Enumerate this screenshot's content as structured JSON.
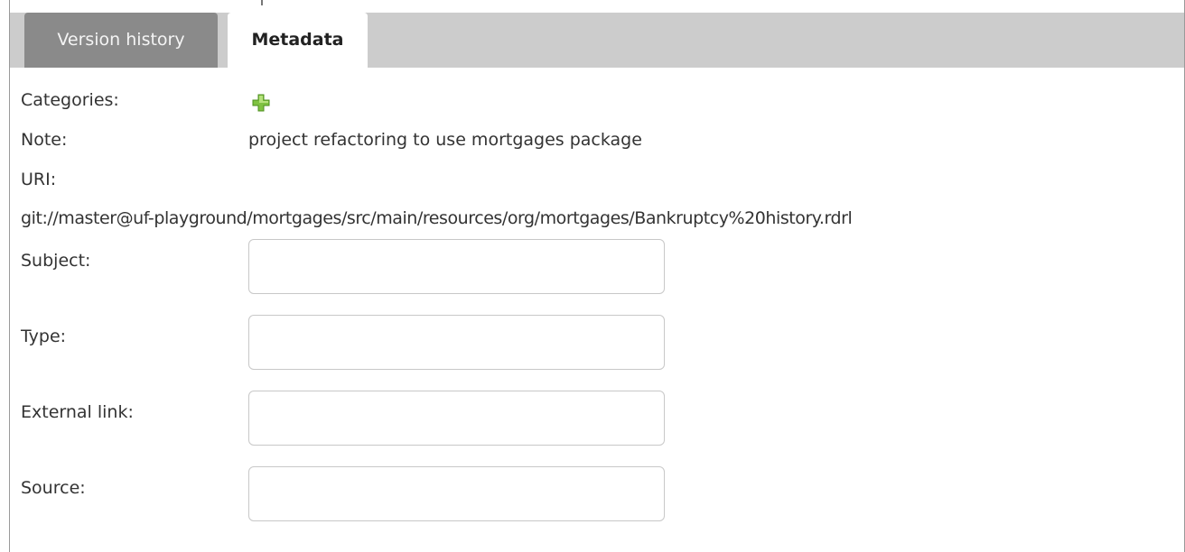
{
  "tabs": [
    {
      "label": "Version history",
      "active": false
    },
    {
      "label": "Metadata",
      "active": true
    }
  ],
  "metadata": {
    "categories_label": "Categories:",
    "add_category_icon": "plus-icon",
    "note_label": "Note:",
    "note_value": "project refactoring to use mortgages package",
    "uri_label": "URI:",
    "uri_value": "git://master@uf-playground/mortgages/src/main/resources/org/mortgages/Bankruptcy%20history.rdrl",
    "subject_label": "Subject:",
    "subject_value": "",
    "type_label": "Type:",
    "type_value": "",
    "external_link_label": "External link:",
    "external_link_value": "",
    "source_label": "Source:",
    "source_value": ""
  },
  "colors": {
    "tab_bar": "#cccccc",
    "inactive_tab": "#8a8a8a",
    "active_tab": "#ffffff",
    "add_icon": "#7fc242"
  }
}
